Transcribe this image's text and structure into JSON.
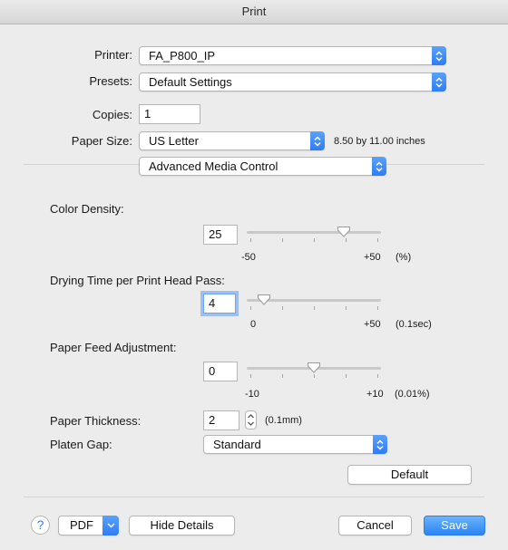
{
  "window": {
    "title": "Print"
  },
  "printer": {
    "label": "Printer:",
    "value": "FA_P800_IP"
  },
  "presets": {
    "label": "Presets:",
    "value": "Default Settings"
  },
  "copies": {
    "label": "Copies:",
    "value": "1"
  },
  "paper_size": {
    "label": "Paper Size:",
    "value": "US Letter",
    "dimensions": "8.50 by 11.00 inches"
  },
  "section": {
    "value": "Advanced Media Control"
  },
  "color_density": {
    "label": "Color Density:",
    "value": "25",
    "min": "-50",
    "max": "+50",
    "unit": "(%)",
    "fraction": 0.75
  },
  "drying_time": {
    "label": "Drying Time per Print Head Pass:",
    "value": "4",
    "min": "0",
    "max": "+50",
    "unit": "(0.1sec)",
    "fraction": 0.08
  },
  "paper_feed": {
    "label": "Paper Feed Adjustment:",
    "value": "0",
    "min": "-10",
    "max": "+10",
    "unit": "(0.01%)",
    "fraction": 0.5
  },
  "paper_thickness": {
    "label": "Paper Thickness:",
    "value": "2",
    "unit": "(0.1mm)"
  },
  "platen_gap": {
    "label": "Platen Gap:",
    "value": "Standard"
  },
  "buttons": {
    "default": "Default",
    "help": "?",
    "pdf": "PDF",
    "hide_details": "Hide Details",
    "cancel": "Cancel",
    "save": "Save"
  },
  "colors": {
    "accent": "#2f7cf6",
    "window_bg": "#ececec"
  }
}
